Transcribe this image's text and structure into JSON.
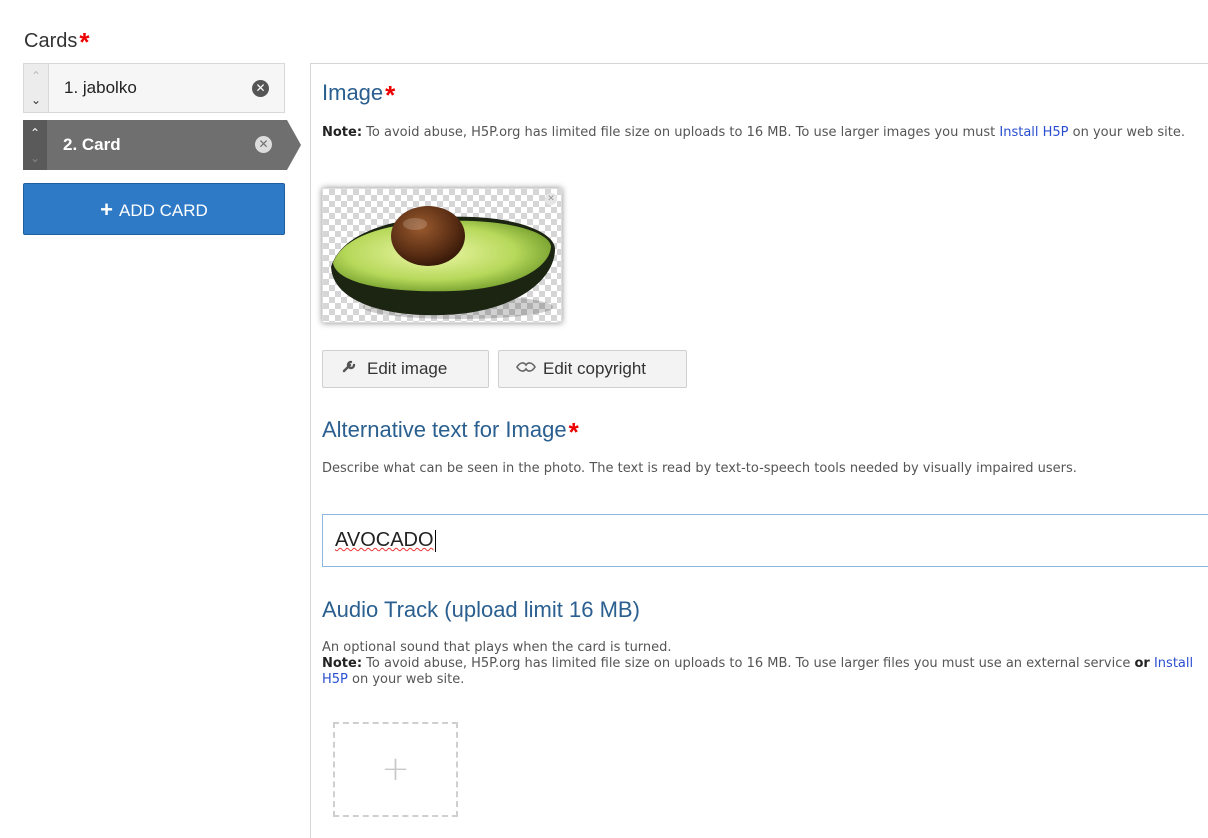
{
  "cards_section": {
    "title": "Cards",
    "required_mark": "*"
  },
  "cards": [
    {
      "label": "1. jabolko",
      "selected": false
    },
    {
      "label": "2. Card",
      "selected": true
    }
  ],
  "add_card": {
    "label": "ADD CARD",
    "icon": "+"
  },
  "image_field": {
    "title": "Image",
    "required_mark": "*",
    "note_prefix": "Note:",
    "note_text": " To avoid abuse, H5P.org has limited file size on uploads to 16 MB. To use larger images you must ",
    "note_link": "Install H5P",
    "note_suffix": " on your web site.",
    "thumbnail_alt": "avocado",
    "edit_image_label": "Edit image",
    "edit_copyright_label": "Edit copyright"
  },
  "alt_text_field": {
    "title": "Alternative text for Image",
    "required_mark": "*",
    "description": "Describe what can be seen in the photo. The text is read by text-to-speech tools needed by visually impaired users.",
    "value": "AVOCADO"
  },
  "audio_field": {
    "title": "Audio Track (upload limit 16 MB)",
    "description": "An optional sound that plays when the card is turned.",
    "note_prefix": "Note:",
    "note_text": " To avoid abuse, H5P.org has limited file size on uploads to 16 MB. To use larger files you must use an external service ",
    "note_or": "or",
    "note_space": " ",
    "note_link": "Install H5P",
    "note_suffix": " on your web site.",
    "add_icon": "+"
  },
  "colors": {
    "accent": "#2f7ac6",
    "heading": "#2a5f8f",
    "required": "#e00000",
    "link": "#2a4fd0",
    "selected_card": "#6f6f6f"
  }
}
